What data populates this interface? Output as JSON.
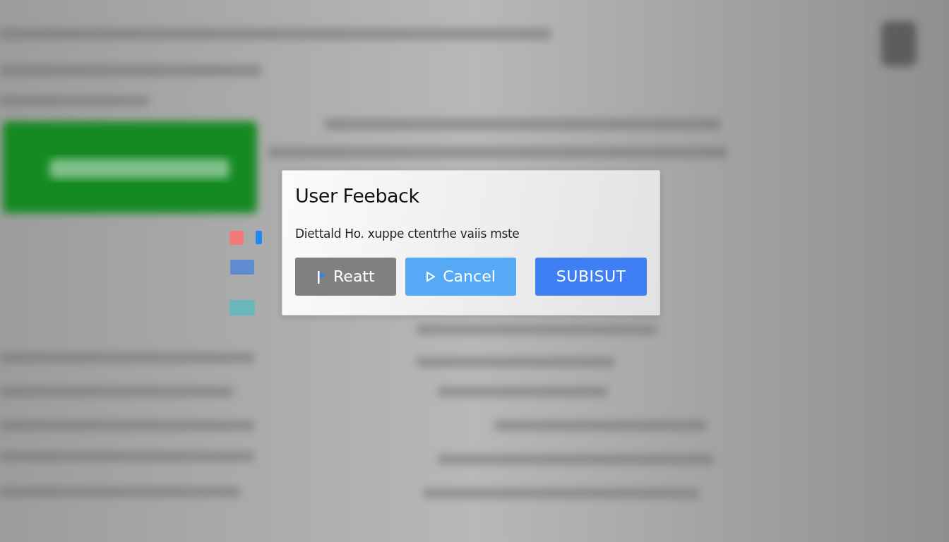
{
  "dialog": {
    "title": "User Feeback",
    "message": "Diettald Ho. xuppe ctentrhe vaiis mste",
    "buttons": [
      {
        "label": "Reatt",
        "kind": "secondary"
      },
      {
        "label": "Cancel",
        "kind": "info"
      },
      {
        "label": "SUBISUT",
        "kind": "primary"
      }
    ]
  }
}
